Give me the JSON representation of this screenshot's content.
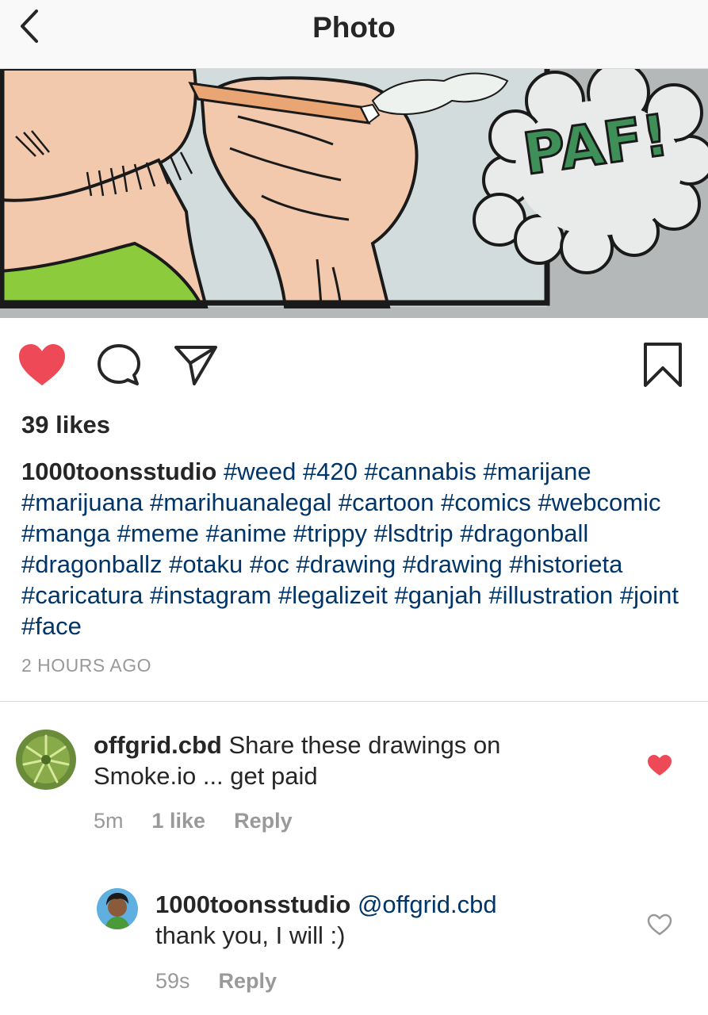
{
  "header": {
    "title": "Photo",
    "back_icon": "chevron-left-icon"
  },
  "photo": {
    "sound_effect": "PAF!"
  },
  "actions": {
    "like_icon": "heart-filled-icon",
    "like_color": "#ed4956",
    "comment_icon": "comment-icon",
    "share_icon": "paper-plane-icon",
    "save_icon": "bookmark-icon"
  },
  "post": {
    "likes": "39 likes",
    "username": "1000toonsstudio",
    "hashtags": [
      "#weed",
      "#420",
      "#cannabis",
      "#marijane",
      "#marijuana",
      "#marihuanalegal",
      "#cartoon",
      "#comics",
      "#webcomic",
      "#manga",
      "#meme",
      "#anime",
      "#trippy",
      "#lsdtrip",
      "#dragonball",
      "#dragonballz",
      "#otaku",
      "#oc",
      "#drawing",
      "#drawing",
      "#historieta",
      "#caricatura",
      "#instagram",
      "#legalizeit",
      "#ganjah",
      "#illustration",
      "#joint",
      "#face"
    ],
    "timestamp": "2 HOURS AGO"
  },
  "comments": [
    {
      "username": "offgrid.cbd",
      "text": "Share these drawings on Smoke.io ... get paid",
      "time": "5m",
      "likes": "1 like",
      "reply_label": "Reply",
      "liked": true
    },
    {
      "username": "1000toonsstudio",
      "mention": "@offgrid.cbd",
      "text": "thank you, I will :)",
      "time": "59s",
      "reply_label": "Reply",
      "liked": false
    }
  ]
}
